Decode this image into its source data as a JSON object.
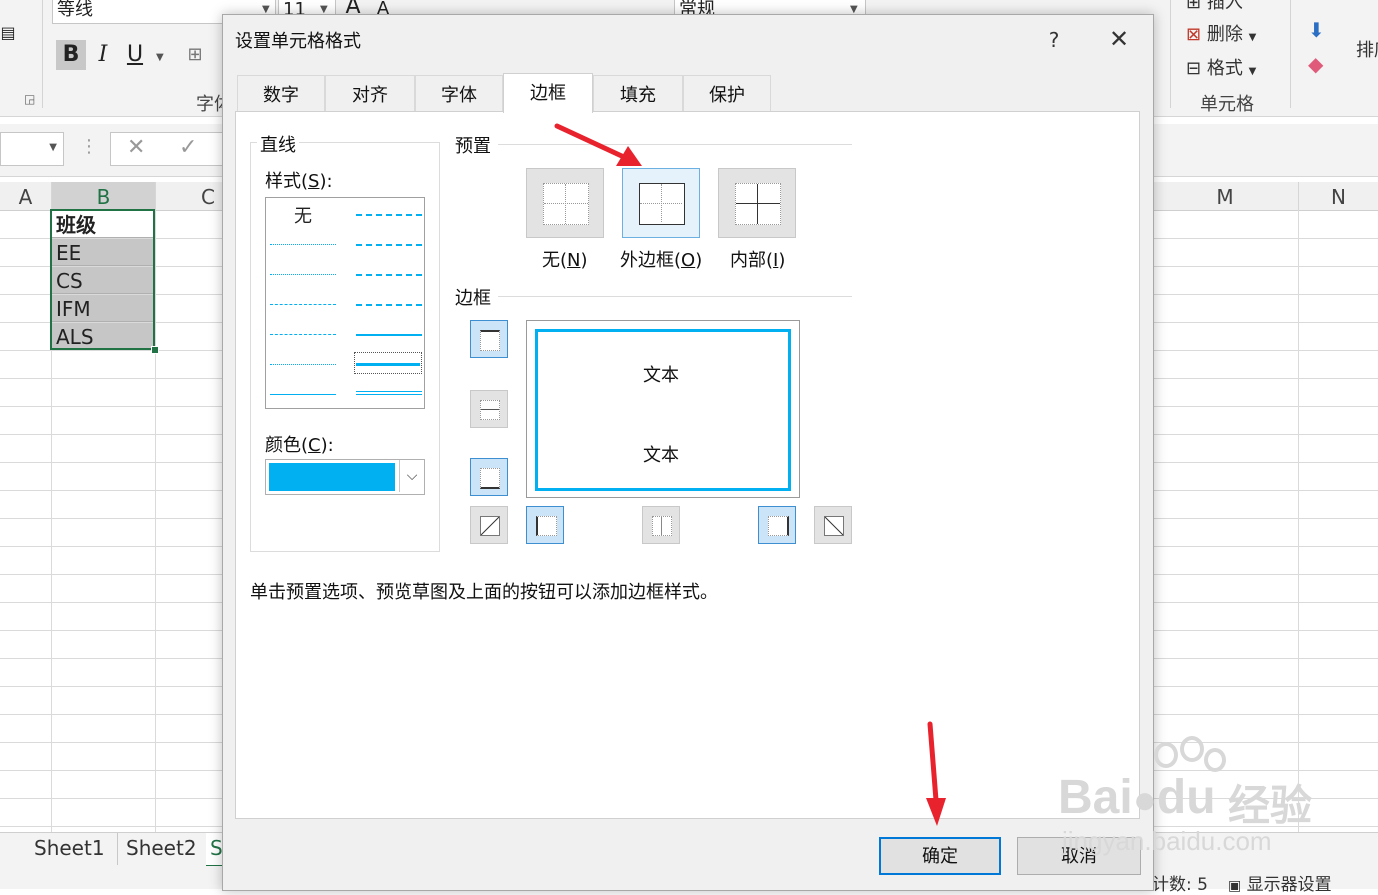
{
  "ribbon": {
    "font_name": "等线",
    "font_size": "11",
    "number_format": "常规",
    "font_group_label": "字体",
    "cells_group_label": "单元格",
    "insert_label": "插入",
    "delete_label": "删除",
    "format_label": "格式",
    "sort_label": "排序",
    "bold": "B",
    "italic": "I",
    "underline": "U",
    "font_grow": "A",
    "font_shrink": "A"
  },
  "grid": {
    "columns": [
      "A",
      "B",
      "C",
      "M",
      "N"
    ],
    "selected_column": "B",
    "cells": [
      "班级",
      "EE",
      "CS",
      "IFM",
      "ALS"
    ]
  },
  "sheet_tabs": [
    "Sheet1",
    "Sheet2",
    "S"
  ],
  "status": {
    "count": "计数: 5",
    "display_settings": "显示器设置"
  },
  "dialog": {
    "title": "设置单元格格式",
    "help": "?",
    "close": "✕",
    "tabs": [
      "数字",
      "对齐",
      "字体",
      "边框",
      "填充",
      "保护"
    ],
    "active_tab": "边框",
    "line_section": "直线",
    "style_label": "样式(",
    "style_key": "S",
    "style_none": "无",
    "color_label": "颜色(",
    "color_key": "C",
    "colon_paren": "):",
    "selected_color": "#00b0f0",
    "presets_section": "预置",
    "presets": [
      {
        "label": "无(",
        "key": "N"
      },
      {
        "label": "外边框(",
        "key": "O"
      },
      {
        "label": "内部(",
        "key": "I"
      }
    ],
    "border_section": "边框",
    "preview_text": "文本",
    "hint": "单击预置选项、预览草图及上面的按钮可以添加边框样式。",
    "ok": "确定",
    "cancel": "取消"
  },
  "watermark": {
    "brand": "Bai",
    "brand2": "du",
    "cn": "经验",
    "url": "jingyan.baidu.com"
  },
  "colors": {
    "excel_green": "#217346",
    "accent_blue": "#0078d7",
    "line_color": "#00b0f0",
    "arrow_red": "#e8232d"
  }
}
